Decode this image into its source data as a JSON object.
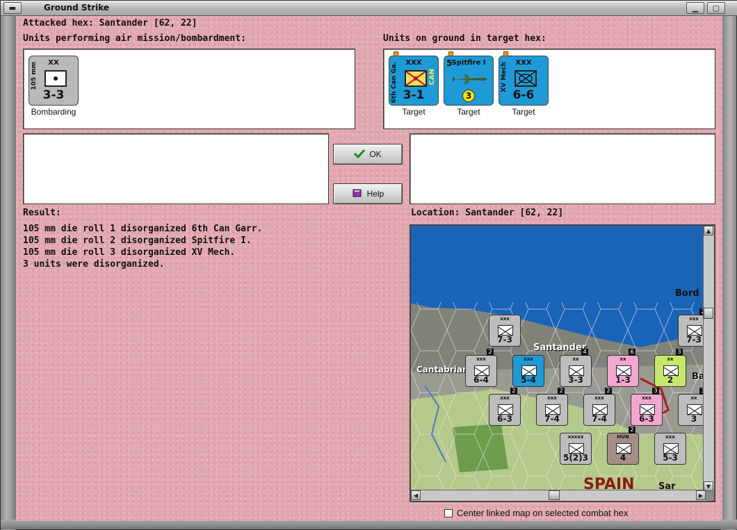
{
  "window": {
    "title": "Ground Strike"
  },
  "header": {
    "attacked_hex": "Attacked hex: Santander  [62, 22]",
    "air_units_label": "Units performing air mission/bombardment:",
    "ground_units_label": "Units on ground in target hex:"
  },
  "air_units": [
    {
      "top": "XX",
      "side": "105 mm",
      "value": "3-3",
      "caption": "Bombarding",
      "color": "#b9b9b9"
    }
  ],
  "ground_units": [
    {
      "top": "XXX",
      "side": "6th Can Ga.",
      "tag": "CAN",
      "value": "3-1",
      "caption": "Target",
      "color": "#1e9ad6"
    },
    {
      "top": "Spitfire I",
      "side": "5",
      "value": "3",
      "caption": "Target",
      "color": "#1e9ad6"
    },
    {
      "top": "XXX",
      "side": "XV Mech",
      "value": "6-6",
      "caption": "Target",
      "color": "#1e9ad6"
    }
  ],
  "buttons": {
    "ok": "OK",
    "help": "Help"
  },
  "result": {
    "label": "Result:",
    "lines": [
      "105 mm die roll 1 disorganized 6th Can Garr.",
      "105 mm die roll 2 disorganized Spitfire I.",
      "105 mm die roll 3 disorganized XV Mech.",
      "3 units were disorganized."
    ]
  },
  "location": {
    "label": "Location:  Santander  [62, 22]",
    "map_labels": {
      "city": "Santander",
      "region": "Cantabrian",
      "country": "SPAIN",
      "bord": "Bord",
      "ba": "Ba",
      "sar": "Sar"
    },
    "units": [
      {
        "v": "7-3",
        "t": "xxx",
        "c": "#bdbdbd"
      },
      {
        "v": "7-3",
        "t": "xxx",
        "c": "#bdbdbd",
        "stack": "2"
      },
      {
        "v": "6-4",
        "t": "xxx",
        "c": "#bdbdbd",
        "stack": "2"
      },
      {
        "v": "5-4",
        "t": "xxx",
        "c": "#1e9ad6"
      },
      {
        "v": "3-3",
        "t": "xx",
        "c": "#bdbdbd",
        "stack": "4"
      },
      {
        "v": "1-3",
        "t": "xx",
        "c": "#f2a7cf",
        "stack": "6"
      },
      {
        "v": "2",
        "t": "xx",
        "c": "#c6e86a",
        "stack": "3"
      },
      {
        "v": "6-3",
        "t": "xxx",
        "c": "#bdbdbd",
        "stack": "2"
      },
      {
        "v": "7-4",
        "t": "xxx",
        "c": "#bdbdbd",
        "stack": "2"
      },
      {
        "v": "7-4",
        "t": "xxx",
        "c": "#bdbdbd",
        "stack": "2"
      },
      {
        "v": "6-3",
        "t": "xxx",
        "c": "#f2a7cf",
        "stack": "3"
      },
      {
        "v": "3",
        "t": "xx",
        "c": "#bdbdbd",
        "stack": "3"
      },
      {
        "v": "5(2)3",
        "t": "xxxxx",
        "c": "#bdbdbd"
      },
      {
        "v": "4",
        "t": "HUN",
        "c": "#a58e88",
        "stack": "2"
      },
      {
        "v": "5-3",
        "t": "xxx",
        "c": "#bdbdbd"
      }
    ]
  },
  "center_checkbox": {
    "label": "Center linked map on selected combat hex",
    "checked": false
  }
}
